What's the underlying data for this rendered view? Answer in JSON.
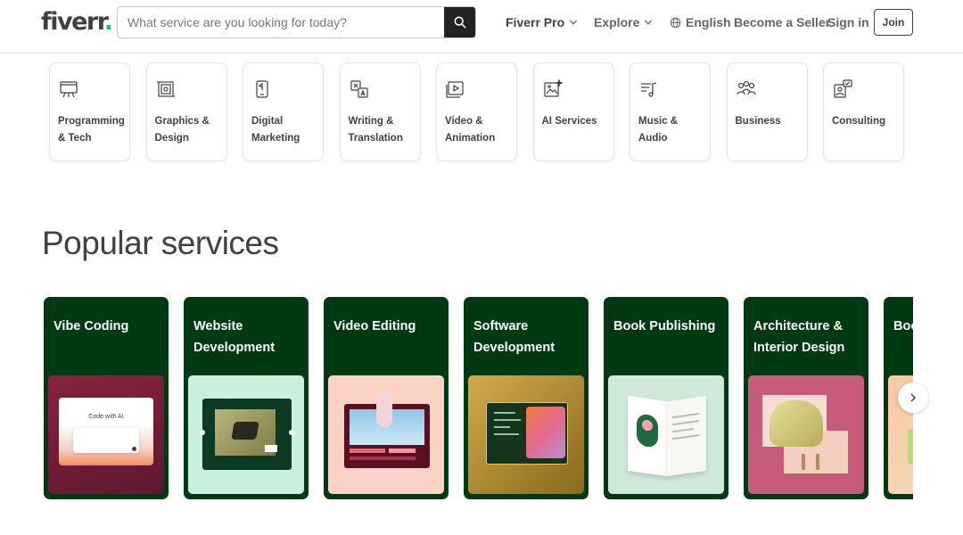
{
  "header": {
    "logo_text": "fiverr",
    "logo_dot": ".",
    "search_placeholder": "What service are you looking for today?",
    "nav": {
      "fiverr_pro": "Fiverr Pro",
      "explore": "Explore",
      "language": "English",
      "become_seller": "Become a Seller",
      "sign_in": "Sign in",
      "join": "Join"
    }
  },
  "categories": [
    {
      "label": "Programming & Tech",
      "icon": "programming-icon"
    },
    {
      "label": "Graphics & Design",
      "icon": "graphics-design-icon"
    },
    {
      "label": "Digital Marketing",
      "icon": "digital-marketing-icon"
    },
    {
      "label": "Writing & Translation",
      "icon": "writing-translation-icon"
    },
    {
      "label": "Video & Animation",
      "icon": "video-animation-icon"
    },
    {
      "label": "AI Services",
      "icon": "ai-services-icon"
    },
    {
      "label": "Music & Audio",
      "icon": "music-audio-icon"
    },
    {
      "label": "Business",
      "icon": "business-icon"
    },
    {
      "label": "Consulting",
      "icon": "consulting-icon"
    }
  ],
  "popular": {
    "title": "Popular services",
    "services": [
      {
        "title": "Vibe Coding",
        "image_text": "Code with AI"
      },
      {
        "title": "Website Development"
      },
      {
        "title": "Video Editing"
      },
      {
        "title": "Software Development"
      },
      {
        "title": "Book Publishing"
      },
      {
        "title": "Architecture & Interior Design"
      },
      {
        "title": "Book Design"
      }
    ]
  },
  "colors": {
    "brand_green": "#1dbf73",
    "card_green": "#003912",
    "text": "#404145"
  }
}
